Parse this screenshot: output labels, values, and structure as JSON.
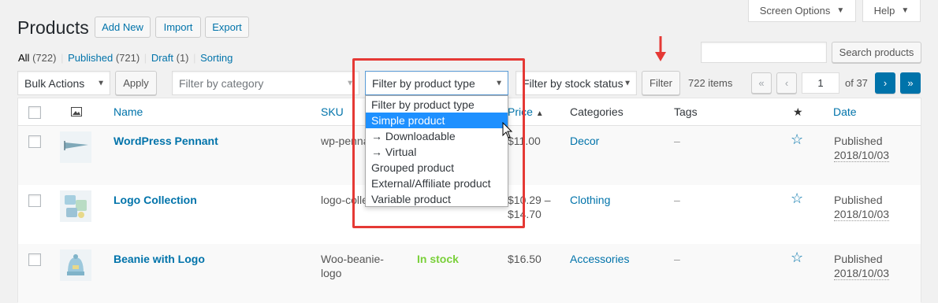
{
  "header": {
    "title": "Products",
    "add_new": "Add New",
    "import": "Import",
    "export": "Export",
    "screen_options": "Screen Options",
    "help": "Help"
  },
  "subsubsub": {
    "all": "All",
    "all_count": "(722)",
    "published": "Published",
    "published_count": "(721)",
    "draft": "Draft",
    "draft_count": "(1)",
    "sorting": "Sorting",
    "sep": "|"
  },
  "search": {
    "value": "",
    "button": "Search products"
  },
  "filters": {
    "bulk_actions": "Bulk Actions",
    "apply": "Apply",
    "category_placeholder": "Filter by category",
    "product_type": "Filter by product type",
    "stock_status": "Filter by stock status",
    "filter_button": "Filter"
  },
  "pagination": {
    "items": "722 items",
    "first": "«",
    "prev": "‹",
    "current_page": "1",
    "of_pages": "of 37",
    "next": "›",
    "last": "»"
  },
  "dropdown": {
    "options": [
      "Filter by product type",
      "Simple product",
      "→ Downloadable",
      "→ Virtual",
      "Grouped product",
      "External/Affiliate product",
      "Variable product"
    ],
    "highlighted_index": 1
  },
  "table": {
    "columns": {
      "name": "Name",
      "sku": "SKU",
      "price": "Price",
      "price_sort": "▲",
      "categories": "Categories",
      "tags": "Tags",
      "featured": "★",
      "date": "Date"
    },
    "rows": [
      {
        "name": "WordPress Pennant",
        "sku": "wp-penna",
        "stock": "",
        "price": "$11.00",
        "price2": "",
        "category": "Decor",
        "tags": "–",
        "date_status": "Published",
        "date": "2018/10/03"
      },
      {
        "name": "Logo Collection",
        "sku": "logo-colle",
        "stock": "",
        "price": "$10.29 –",
        "price2": "$14.70",
        "category": "Clothing",
        "tags": "–",
        "date_status": "Published",
        "date": "2018/10/03"
      },
      {
        "name": "Beanie with Logo",
        "sku": "Woo-beanie-",
        "sku2": "logo",
        "stock": "In stock",
        "price": "$16.50",
        "price2": "",
        "category": "Accessories",
        "tags": "–",
        "date_status": "Published",
        "date": "2018/10/03"
      }
    ]
  },
  "colors": {
    "link": "#0073aa",
    "in_stock": "#7ad03a",
    "highlight": "#e53935",
    "option_selected": "#1e90ff"
  }
}
